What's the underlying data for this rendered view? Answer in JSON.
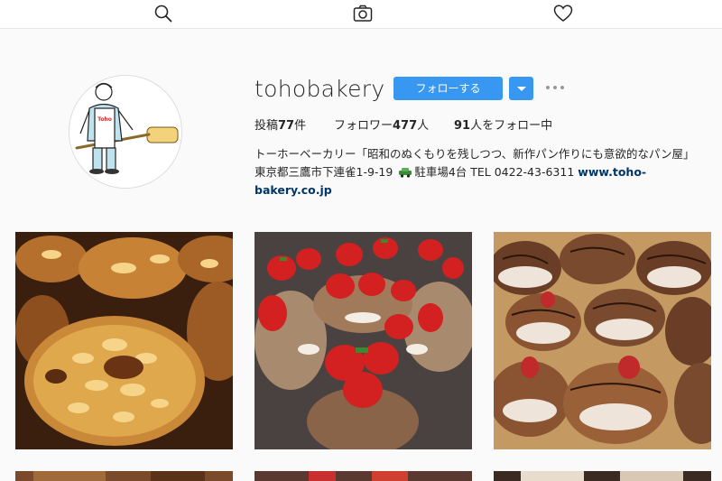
{
  "icons": {
    "search": "search-icon",
    "camera": "camera-icon",
    "heart": "heart-icon",
    "dropdown": "chevron-down-icon",
    "more": "more-options-icon"
  },
  "profile": {
    "username": "tohobakery",
    "follow_label": "フォローする",
    "stats": {
      "posts_prefix": "投稿",
      "posts": "77",
      "posts_suffix": "件",
      "followers_prefix": "フォロワー",
      "followers": "477",
      "followers_suffix": "人",
      "following": "91",
      "following_suffix": "人をフォロー中"
    },
    "bio": {
      "line1": "トーホーベーカリー「昭和のぬくもりを残しつつ、新作パン作りにも意欲的なパン屋」",
      "line2_address": "東京都三鷹市下連雀1-9-19",
      "line2_parking": "駐車場4台 TEL 0422-43-6311",
      "link_part1": "www.toho-",
      "link_part2": "bakery.co.jp"
    }
  },
  "posts": [
    {
      "subject": "almond pastries"
    },
    {
      "subject": "strawberry tarts"
    },
    {
      "subject": "chocolate-drizzled pastries"
    }
  ],
  "colors": {
    "accent": "#3897f0",
    "link": "#003569",
    "background": "#fafafa"
  }
}
